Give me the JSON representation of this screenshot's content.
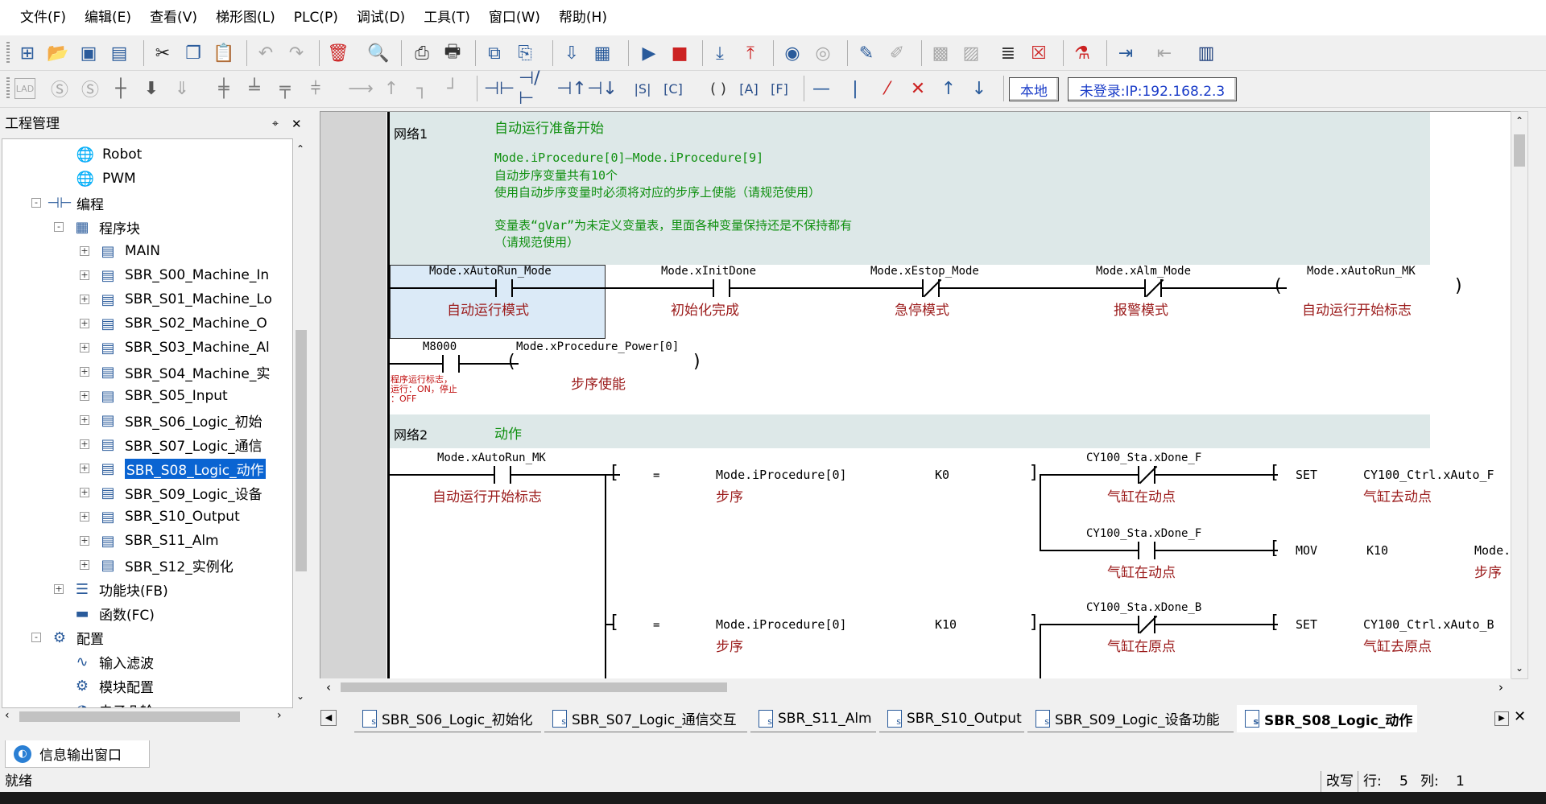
{
  "menu": [
    "文件(F)",
    "编辑(E)",
    "查看(V)",
    "梯形图(L)",
    "PLC(P)",
    "调试(D)",
    "工具(T)",
    "窗口(W)",
    "帮助(H)"
  ],
  "toolbar2": {
    "mode_local": "本地",
    "login_status": "未登录:IP:192.168.2.3"
  },
  "project": {
    "title": "工程管理",
    "pin": "⌖",
    "close": "✕",
    "tree": [
      {
        "label": "Robot",
        "icon": "robot-icon"
      },
      {
        "label": "PWM",
        "icon": "pwm-icon"
      },
      {
        "label": "编程",
        "icon": "programming-icon"
      },
      {
        "label": "程序块",
        "icon": "program-block-icon"
      },
      {
        "label": "MAIN",
        "icon": "main-program-icon"
      },
      {
        "label": "SBR_S00_Machine_In",
        "icon": "subroutine-icon"
      },
      {
        "label": "SBR_S01_Machine_Lo",
        "icon": "subroutine-icon"
      },
      {
        "label": "SBR_S02_Machine_O",
        "icon": "subroutine-icon"
      },
      {
        "label": "SBR_S03_Machine_Al",
        "icon": "subroutine-icon"
      },
      {
        "label": "SBR_S04_Machine_实",
        "icon": "subroutine-icon"
      },
      {
        "label": "SBR_S05_Input",
        "icon": "subroutine-icon"
      },
      {
        "label": "SBR_S06_Logic_初始",
        "icon": "subroutine-icon"
      },
      {
        "label": "SBR_S07_Logic_通信",
        "icon": "subroutine-icon"
      },
      {
        "label": "SBR_S08_Logic_动作",
        "icon": "subroutine-icon",
        "selected": true
      },
      {
        "label": "SBR_S09_Logic_设备",
        "icon": "subroutine-icon"
      },
      {
        "label": "SBR_S10_Output",
        "icon": "subroutine-icon"
      },
      {
        "label": "SBR_S11_Alm",
        "icon": "subroutine-icon"
      },
      {
        "label": "SBR_S12_实例化",
        "icon": "subroutine-icon"
      },
      {
        "label": "功能块(FB)",
        "icon": "function-block-icon"
      },
      {
        "label": "函数(FC)",
        "icon": "function-icon"
      },
      {
        "label": "配置",
        "icon": "config-icon"
      },
      {
        "label": "输入滤波",
        "icon": "input-filter-icon"
      },
      {
        "label": "模块配置",
        "icon": "module-config-icon"
      },
      {
        "label": "电子凸轮",
        "icon": "electronic-cam-icon"
      }
    ]
  },
  "ladder": {
    "net1": {
      "label": "网络1",
      "title": "自动运行准备开始",
      "comments": [
        "Mode.iProcedure[0]—Mode.iProcedure[9]",
        "自动步序变量共有10个",
        "使用自动步序变量时必须将对应的步序上使能（请规范使用）",
        "",
        "变量表“gVar”为未定义变量表，里面各种变量保持还是不保持都有",
        "（请规范使用）"
      ],
      "row1": [
        {
          "var": "Mode.xAutoRun_Mode",
          "cmt": "自动运行模式",
          "type": "no"
        },
        {
          "var": "Mode.xInitDone",
          "cmt": "初始化完成",
          "type": "no"
        },
        {
          "var": "Mode.xEstop_Mode",
          "cmt": "急停模式",
          "type": "nc"
        },
        {
          "var": "Mode.xAlm_Mode",
          "cmt": "报警模式",
          "type": "nc"
        }
      ],
      "row1_coil": {
        "var": "Mode.xAutoRun_MK",
        "cmt": "自动运行开始标志"
      },
      "row2_contact": {
        "var": "M8000",
        "cmt_lines": [
          "程序运行标志，",
          "运行：ON，停止",
          "：OFF"
        ]
      },
      "row2_coil": {
        "var": "Mode.xProcedure_Power[0]",
        "cmt": "步序使能"
      }
    },
    "net2": {
      "label": "网络2",
      "title": "动作",
      "contact": {
        "var": "Mode.xAutoRun_MK",
        "cmt": "自动运行开始标志"
      },
      "cmp1": {
        "op": "=",
        "a": "Mode.iProcedure[0]",
        "a_cmt": "步序",
        "b": "K0"
      },
      "cmp2": {
        "op": "=",
        "a": "Mode.iProcedure[0]",
        "a_cmt": "步序",
        "b": "K10"
      },
      "b1": {
        "var": "CY100_Sta.xDone_F",
        "cmt": "气缸在动点",
        "type": "nc",
        "ins": "SET",
        "target": "CY100_Ctrl.xAuto_F",
        "target_cmt": "气缸去动点"
      },
      "b2": {
        "var": "CY100_Sta.xDone_F",
        "cmt": "气缸在动点",
        "type": "no",
        "ins": "MOV",
        "src": "K10",
        "target": "Mode.",
        "target_cmt": "步序"
      },
      "b3": {
        "var": "CY100_Sta.xDone_B",
        "cmt": "气缸在原点",
        "type": "nc",
        "ins": "SET",
        "target": "CY100_Ctrl.xAuto_B",
        "target_cmt": "气缸去原点"
      }
    }
  },
  "tabs": [
    "SBR_S06_Logic_初始化",
    "SBR_S07_Logic_通信交互",
    "SBR_S11_Alm",
    "SBR_S10_Output",
    "SBR_S09_Logic_设备功能",
    "SBR_S08_Logic_动作"
  ],
  "output_tab": "信息输出窗口",
  "status": {
    "ready": "就绪",
    "mode": "改写",
    "row_label": "行:",
    "row": "5",
    "col_label": "列:",
    "col": "1"
  }
}
